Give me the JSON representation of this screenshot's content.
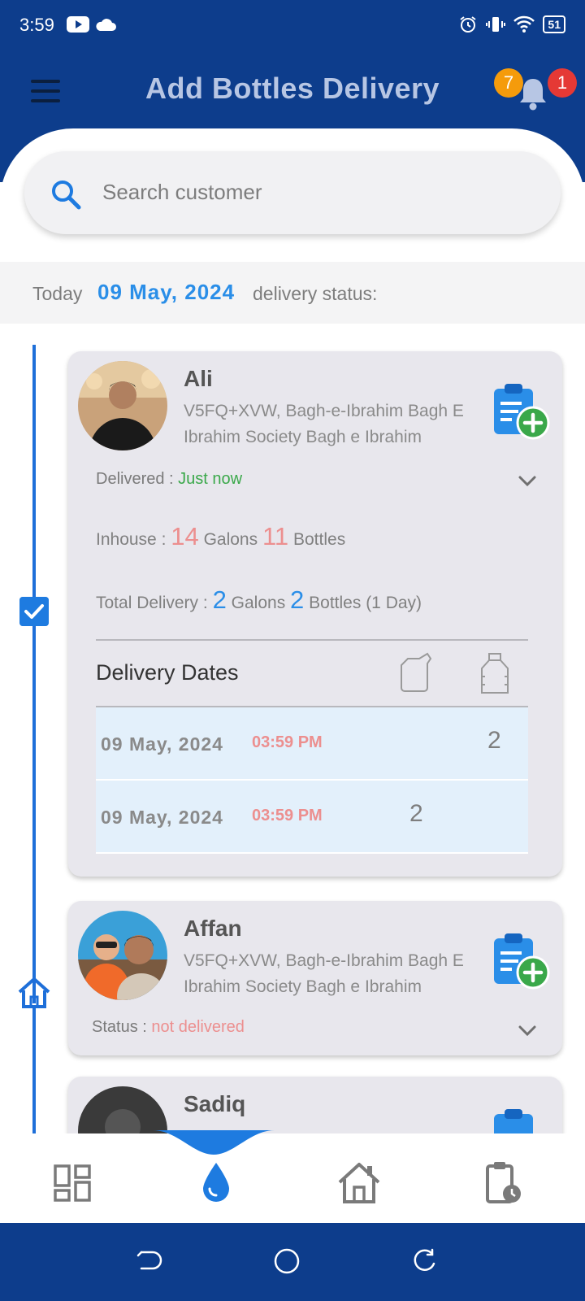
{
  "status_bar": {
    "time": "3:59",
    "battery": "51"
  },
  "header": {
    "title": "Add Bottles Delivery",
    "badge_left": "7",
    "badge_right": "1"
  },
  "search": {
    "placeholder": "Search customer"
  },
  "date_bar": {
    "prefix": "Today",
    "date": "09 May, 2024",
    "suffix": "delivery status:"
  },
  "customers": [
    {
      "name": "Ali",
      "address": "V5FQ+XVW, Bagh-e-Ibrahim Bagh E Ibrahim Society Bagh e Ibrahim",
      "status_label": "Delivered : ",
      "status_value": "Just now",
      "inhouse": {
        "label": "Inhouse  :",
        "galons": "14",
        "galons_label": "Galons",
        "bottles": "11",
        "bottles_label": "Bottles"
      },
      "total_delivery": {
        "label": "Total Delivery  :",
        "galons": "2",
        "galons_label": "Galons",
        "bottles": "2",
        "bottles_label": "Bottles",
        "days": "(1 Day)"
      },
      "delivery_dates_title": "Delivery Dates",
      "delivery_rows": [
        {
          "date": "09 May, 2024",
          "time": "03:59 PM",
          "galons": "",
          "bottles": "2"
        },
        {
          "date": "09 May, 2024",
          "time": "03:59 PM",
          "galons": "2",
          "bottles": ""
        }
      ]
    },
    {
      "name": "Affan",
      "address": "V5FQ+XVW, Bagh-e-Ibrahim Bagh E Ibrahim Society Bagh e Ibrahim",
      "status_label": "Status : ",
      "status_value": "not delivered"
    },
    {
      "name": "Sadiq"
    }
  ],
  "colors": {
    "primary": "#0d3d8c",
    "accent_blue": "#2a8ee8",
    "accent_red": "#ec8f8f",
    "delivered_green": "#3aa84a",
    "card_bg": "#e8e7ed"
  },
  "icons": {
    "nav": [
      "dashboard-icon",
      "water-drop-icon",
      "home-icon",
      "clipboard-clock-icon"
    ],
    "system": [
      "back-icon",
      "home-circle-icon",
      "recent-icon"
    ]
  }
}
